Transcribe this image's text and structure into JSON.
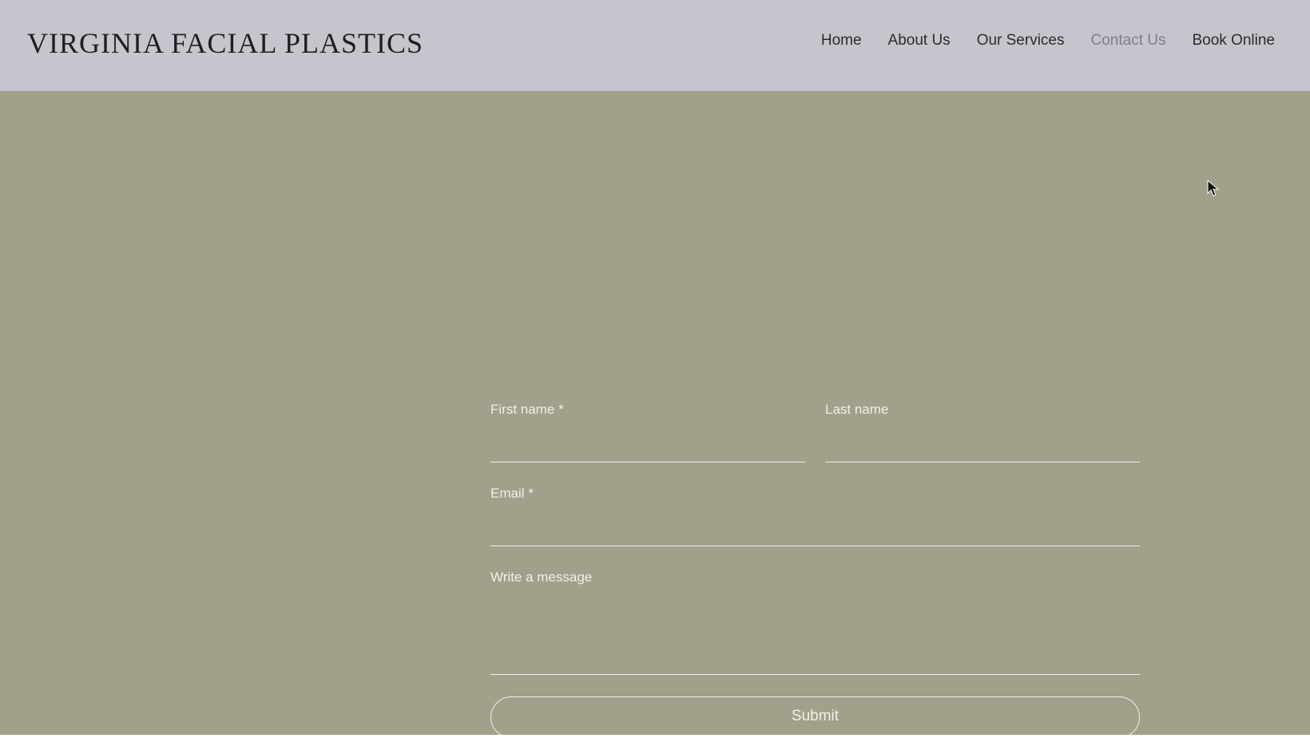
{
  "header": {
    "logo_text": "VIRGINIA FACIAL PLASTICS",
    "nav": [
      {
        "label": "Home",
        "active": false
      },
      {
        "label": "About Us",
        "active": false
      },
      {
        "label": "Our Services",
        "active": false
      },
      {
        "label": "Contact Us",
        "active": true
      },
      {
        "label": "Book Online",
        "active": false
      }
    ]
  },
  "form": {
    "first_name_label": "First name *",
    "last_name_label": "Last name",
    "email_label": "Email *",
    "message_label": "Write a message",
    "first_name_value": "",
    "last_name_value": "",
    "email_value": "",
    "message_value": "",
    "submit_label": "Submit"
  },
  "colors": {
    "header_bg": "#c6c5cd",
    "main_bg": "#a1a08a",
    "form_text": "#f1f0e8",
    "nav_text": "#2c2c2c",
    "nav_active": "#7f7f86"
  },
  "icons": {
    "cursor": "mouse-pointer-icon"
  }
}
